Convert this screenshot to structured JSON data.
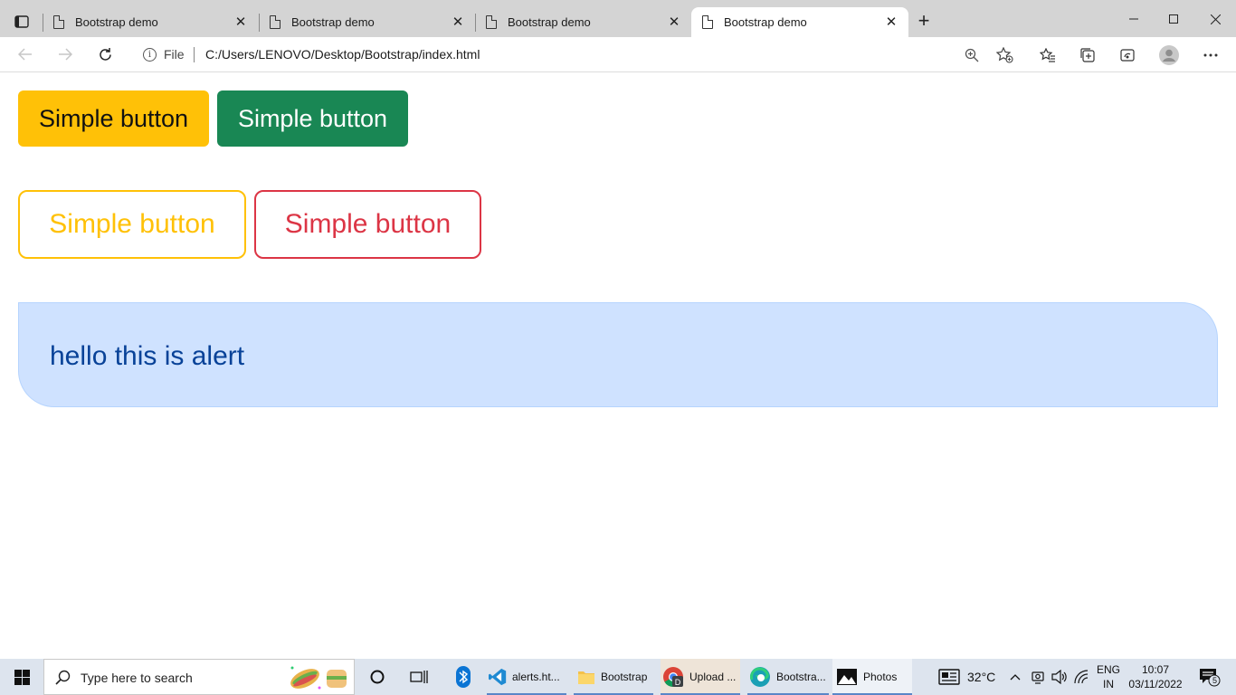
{
  "browser": {
    "tabs": [
      {
        "title": "Bootstrap demo",
        "active": false
      },
      {
        "title": "Bootstrap demo",
        "active": false
      },
      {
        "title": "Bootstrap demo",
        "active": false
      },
      {
        "title": "Bootstrap demo",
        "active": true
      }
    ],
    "tab_close_glyph": "✕",
    "new_tab_glyph": "+",
    "window_controls": {
      "minimize": "—",
      "maximize": "☐",
      "close": "✕"
    },
    "address": {
      "scheme_label": "File",
      "url": "C:/Users/LENOVO/Desktop/Bootstrap/index.html"
    }
  },
  "page": {
    "buttons_row1": [
      {
        "label": "Simple button",
        "variant": "warning",
        "color": "#ffc107"
      },
      {
        "label": "Simple button",
        "variant": "success",
        "color": "#198754"
      }
    ],
    "buttons_row2": [
      {
        "label": "Simple button",
        "variant": "outline-warning",
        "color": "#ffc107"
      },
      {
        "label": "Simple button",
        "variant": "outline-danger",
        "color": "#dc3545"
      }
    ],
    "alert": {
      "text": "hello this is alert",
      "variant": "primary",
      "color": "#cfe2ff"
    }
  },
  "taskbar": {
    "search_placeholder": "Type here to search",
    "apps": [
      {
        "label": "alerts.ht...",
        "icon": "vscode-icon"
      },
      {
        "label": "Bootstrap",
        "icon": "folder-icon"
      },
      {
        "label": "Upload ...",
        "icon": "chrome-icon"
      },
      {
        "label": "Bootstra...",
        "icon": "edge-icon"
      },
      {
        "label": "Photos",
        "icon": "photos-icon"
      }
    ],
    "weather": "32°C",
    "language": {
      "line1": "ENG",
      "line2": "IN"
    },
    "clock": {
      "time": "10:07",
      "date": "03/11/2022"
    },
    "notification_count": "5"
  }
}
